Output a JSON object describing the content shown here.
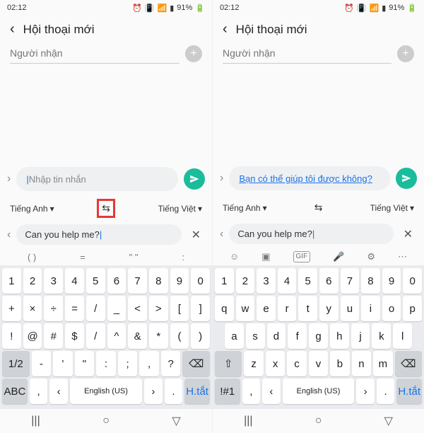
{
  "status": {
    "time": "02:12",
    "battery": "91%"
  },
  "header": {
    "title": "Hội thoại mới"
  },
  "recipient": {
    "placeholder": "Người nhận"
  },
  "message": {
    "placeholder": "Nhập tin nhắn",
    "translated": "Bạn có thể giúp tôi được không?"
  },
  "lang": {
    "source": "Tiếng Anh",
    "target": "Tiếng Việt"
  },
  "translateInput": "Can you help me?",
  "suggestions": {
    "left": [
      "( )",
      "=",
      "\"  \"",
      ":"
    ],
    "right_icons": [
      "emoji",
      "sticker",
      "gif",
      "mic",
      "settings",
      "more"
    ]
  },
  "keyboard": {
    "left": {
      "row1": [
        "1",
        "2",
        "3",
        "4",
        "5",
        "6",
        "7",
        "8",
        "9",
        "0"
      ],
      "row2": [
        "+",
        "×",
        "÷",
        "=",
        "/",
        "_",
        "<",
        ">",
        "[",
        "]"
      ],
      "row3": [
        "!",
        "@",
        "#",
        "$",
        "/",
        "^",
        "&",
        "*",
        "(",
        ")"
      ],
      "row4_left": "1/2",
      "row4": [
        "-",
        "'",
        "\"",
        ":",
        ";",
        ",",
        "?"
      ],
      "row5_left": "ABC",
      "row5_comma": ",",
      "space": "English (US)",
      "row5_dot": ".",
      "row5_right": "H.tắt"
    },
    "right": {
      "row1": [
        "1",
        "2",
        "3",
        "4",
        "5",
        "6",
        "7",
        "8",
        "9",
        "0"
      ],
      "row2": [
        "q",
        "w",
        "e",
        "r",
        "t",
        "y",
        "u",
        "i",
        "o",
        "p"
      ],
      "row3": [
        "a",
        "s",
        "d",
        "f",
        "g",
        "h",
        "j",
        "k",
        "l"
      ],
      "row4": [
        "z",
        "x",
        "c",
        "v",
        "b",
        "n",
        "m"
      ],
      "row5_left": "!#1",
      "row5_comma": ",",
      "space": "English (US)",
      "row5_dot": ".",
      "row5_right": "H.tắt"
    }
  }
}
